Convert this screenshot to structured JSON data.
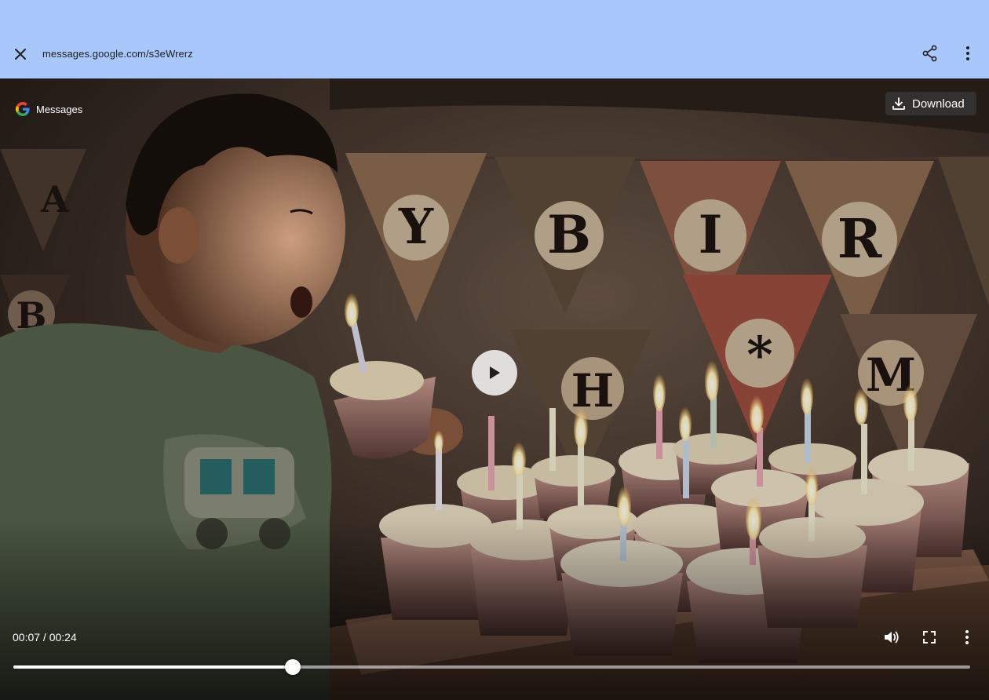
{
  "header": {
    "url": "messages.google.com/s3eWrerz"
  },
  "player": {
    "brand_label": "Messages",
    "download_label": "Download",
    "current_time": "00:07",
    "total_time": "00:24",
    "time_display": "00:07 / 00:24",
    "progress": 0.2917
  },
  "photo": {
    "banner_letters": [
      "A",
      "Y",
      "B",
      "I",
      "R",
      "B",
      "H",
      "*",
      "M"
    ]
  },
  "icons": {
    "close": "close-icon",
    "share": "share-icon",
    "more": "more-vert-icon",
    "google": "google-g-icon",
    "download": "download-icon",
    "play": "play-icon",
    "volume": "volume-icon",
    "fullscreen": "fullscreen-icon",
    "options": "more-vert-icon"
  },
  "colors": {
    "header_bg": "#a8c7fa",
    "header_text": "#1f1f1f",
    "control_text": "#ffffff"
  }
}
